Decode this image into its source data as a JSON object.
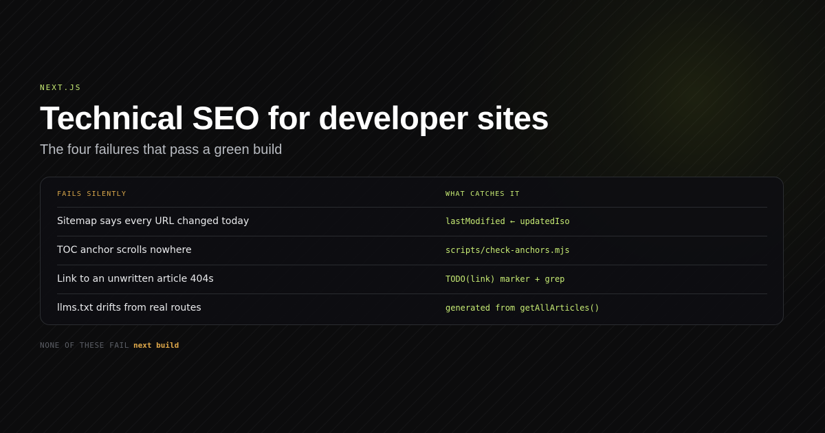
{
  "header": {
    "eyebrow": "NEXT.JS",
    "title": "Technical SEO for developer sites",
    "subtitle": "The four failures that pass a green build"
  },
  "table": {
    "columns": {
      "left": "FAILS SILENTLY",
      "right": "WHAT CATCHES IT"
    },
    "rows": [
      {
        "failure": "Sitemap says every URL changed today",
        "catch": "lastModified ← updatedIso"
      },
      {
        "failure": "TOC anchor scrolls nowhere",
        "catch": "scripts/check-anchors.mjs"
      },
      {
        "failure": "Link to an unwritten article 404s",
        "catch": "TODO(link) marker + grep"
      },
      {
        "failure": "llms.txt drifts from real routes",
        "catch": "generated from getAllArticles()"
      }
    ]
  },
  "footer": {
    "prefix": "NONE OF THESE FAIL",
    "command": "next build"
  },
  "colors": {
    "background": "#0c0c0d",
    "accent_green": "#c6ea73",
    "accent_amber": "#d9a74a",
    "text_primary": "#ffffff",
    "text_muted": "#b9bcc2"
  }
}
